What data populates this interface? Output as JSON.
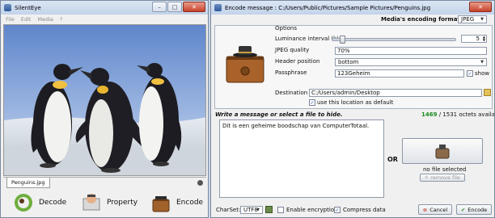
{
  "silenteye": {
    "title": "SilentEye",
    "menu": [
      "File",
      "Edit",
      "Media",
      "?"
    ],
    "image_tab": "Penguins.jpg",
    "actions": {
      "decode": "Decode",
      "property": "Property",
      "encode": "Encode"
    }
  },
  "encode": {
    "title": "Encode message : C:/Users/Public/Pictures/Sample Pictures/Penguins.jpg",
    "format_label": "Media's encoding format :",
    "format_value": "JPEG",
    "options_title": "Options",
    "luminance_label": "Luminance interval (k)",
    "luminance_value": "5",
    "luminance_level": 0.06,
    "quality_label": "JPEG quality",
    "quality_value": "70%",
    "header_label": "Header position",
    "header_value": "bottom",
    "pass_label": "Passphrase",
    "pass_value": "123Geheim",
    "show_label": "show",
    "show_checked": true,
    "dest_label": "Destination :",
    "dest_value": "C:/Users/admin/Desktop",
    "default_label": "use this location as default",
    "default_checked": true,
    "write_label": "Write a message or select a file to hide.",
    "octets_used": "1469",
    "octets_total": " / 1531 octets available",
    "message": "Dit is een geheime boodschap van ComputerTotaal.",
    "or_label": "OR",
    "no_file": "no file selected",
    "remove_file": "remove file",
    "charset_label": "CharSet:",
    "charset_value": "UTF8",
    "encryption_label": "Enable encryption",
    "encryption_checked": false,
    "compress_label": "Compress data",
    "compress_checked": true,
    "cancel_label": "Cancel",
    "encode_label": "Encode"
  },
  "colors": {
    "octets_used": "#1c8a1c",
    "sky": "#7fa0d8",
    "ice": "#dfe6ee"
  }
}
